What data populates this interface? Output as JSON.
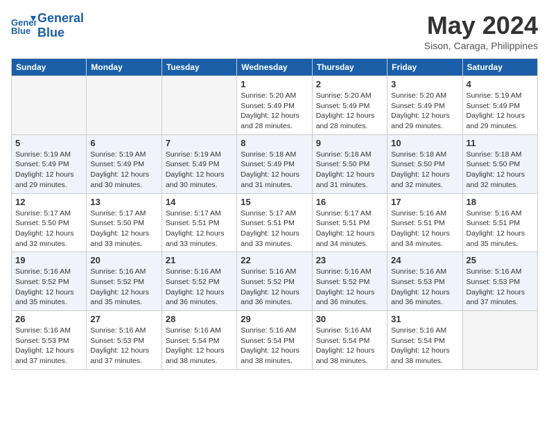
{
  "header": {
    "logo_line1": "General",
    "logo_line2": "Blue",
    "month": "May 2024",
    "location": "Sison, Caraga, Philippines"
  },
  "weekdays": [
    "Sunday",
    "Monday",
    "Tuesday",
    "Wednesday",
    "Thursday",
    "Friday",
    "Saturday"
  ],
  "weeks": [
    [
      {
        "day": "",
        "empty": true
      },
      {
        "day": "",
        "empty": true
      },
      {
        "day": "",
        "empty": true
      },
      {
        "day": "1",
        "sunrise": "5:20 AM",
        "sunset": "5:49 PM",
        "daylight": "12 hours and 28 minutes."
      },
      {
        "day": "2",
        "sunrise": "5:20 AM",
        "sunset": "5:49 PM",
        "daylight": "12 hours and 28 minutes."
      },
      {
        "day": "3",
        "sunrise": "5:20 AM",
        "sunset": "5:49 PM",
        "daylight": "12 hours and 29 minutes."
      },
      {
        "day": "4",
        "sunrise": "5:19 AM",
        "sunset": "5:49 PM",
        "daylight": "12 hours and 29 minutes."
      }
    ],
    [
      {
        "day": "5",
        "sunrise": "5:19 AM",
        "sunset": "5:49 PM",
        "daylight": "12 hours and 29 minutes."
      },
      {
        "day": "6",
        "sunrise": "5:19 AM",
        "sunset": "5:49 PM",
        "daylight": "12 hours and 30 minutes."
      },
      {
        "day": "7",
        "sunrise": "5:19 AM",
        "sunset": "5:49 PM",
        "daylight": "12 hours and 30 minutes."
      },
      {
        "day": "8",
        "sunrise": "5:18 AM",
        "sunset": "5:49 PM",
        "daylight": "12 hours and 31 minutes."
      },
      {
        "day": "9",
        "sunrise": "5:18 AM",
        "sunset": "5:50 PM",
        "daylight": "12 hours and 31 minutes."
      },
      {
        "day": "10",
        "sunrise": "5:18 AM",
        "sunset": "5:50 PM",
        "daylight": "12 hours and 32 minutes."
      },
      {
        "day": "11",
        "sunrise": "5:18 AM",
        "sunset": "5:50 PM",
        "daylight": "12 hours and 32 minutes."
      }
    ],
    [
      {
        "day": "12",
        "sunrise": "5:17 AM",
        "sunset": "5:50 PM",
        "daylight": "12 hours and 32 minutes."
      },
      {
        "day": "13",
        "sunrise": "5:17 AM",
        "sunset": "5:50 PM",
        "daylight": "12 hours and 33 minutes."
      },
      {
        "day": "14",
        "sunrise": "5:17 AM",
        "sunset": "5:51 PM",
        "daylight": "12 hours and 33 minutes."
      },
      {
        "day": "15",
        "sunrise": "5:17 AM",
        "sunset": "5:51 PM",
        "daylight": "12 hours and 33 minutes."
      },
      {
        "day": "16",
        "sunrise": "5:17 AM",
        "sunset": "5:51 PM",
        "daylight": "12 hours and 34 minutes."
      },
      {
        "day": "17",
        "sunrise": "5:16 AM",
        "sunset": "5:51 PM",
        "daylight": "12 hours and 34 minutes."
      },
      {
        "day": "18",
        "sunrise": "5:16 AM",
        "sunset": "5:51 PM",
        "daylight": "12 hours and 35 minutes."
      }
    ],
    [
      {
        "day": "19",
        "sunrise": "5:16 AM",
        "sunset": "5:52 PM",
        "daylight": "12 hours and 35 minutes."
      },
      {
        "day": "20",
        "sunrise": "5:16 AM",
        "sunset": "5:52 PM",
        "daylight": "12 hours and 35 minutes."
      },
      {
        "day": "21",
        "sunrise": "5:16 AM",
        "sunset": "5:52 PM",
        "daylight": "12 hours and 36 minutes."
      },
      {
        "day": "22",
        "sunrise": "5:16 AM",
        "sunset": "5:52 PM",
        "daylight": "12 hours and 36 minutes."
      },
      {
        "day": "23",
        "sunrise": "5:16 AM",
        "sunset": "5:52 PM",
        "daylight": "12 hours and 36 minutes."
      },
      {
        "day": "24",
        "sunrise": "5:16 AM",
        "sunset": "5:53 PM",
        "daylight": "12 hours and 36 minutes."
      },
      {
        "day": "25",
        "sunrise": "5:16 AM",
        "sunset": "5:53 PM",
        "daylight": "12 hours and 37 minutes."
      }
    ],
    [
      {
        "day": "26",
        "sunrise": "5:16 AM",
        "sunset": "5:53 PM",
        "daylight": "12 hours and 37 minutes."
      },
      {
        "day": "27",
        "sunrise": "5:16 AM",
        "sunset": "5:53 PM",
        "daylight": "12 hours and 37 minutes."
      },
      {
        "day": "28",
        "sunrise": "5:16 AM",
        "sunset": "5:54 PM",
        "daylight": "12 hours and 38 minutes."
      },
      {
        "day": "29",
        "sunrise": "5:16 AM",
        "sunset": "5:54 PM",
        "daylight": "12 hours and 38 minutes."
      },
      {
        "day": "30",
        "sunrise": "5:16 AM",
        "sunset": "5:54 PM",
        "daylight": "12 hours and 38 minutes."
      },
      {
        "day": "31",
        "sunrise": "5:16 AM",
        "sunset": "5:54 PM",
        "daylight": "12 hours and 38 minutes."
      },
      {
        "day": "",
        "empty": true
      }
    ]
  ]
}
